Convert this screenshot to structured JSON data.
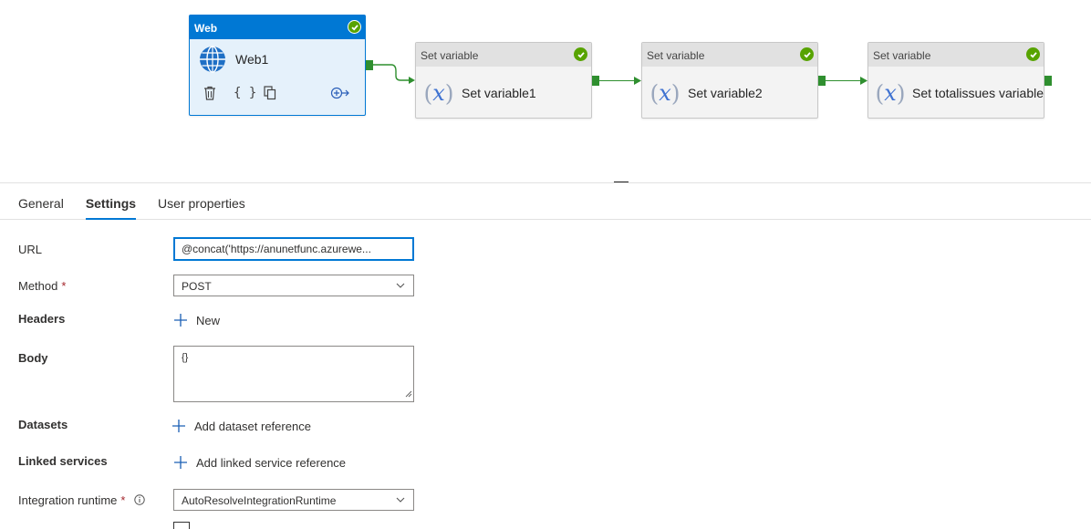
{
  "pipeline": {
    "web_activity": {
      "type_label": "Web",
      "name": "Web1",
      "icon": "globe-icon",
      "status": "succeeded"
    },
    "set_variable_1": {
      "type_label": "Set variable",
      "name": "Set variable1",
      "icon": "variable-icon"
    },
    "set_variable_2": {
      "type_label": "Set variable",
      "name": "Set variable2",
      "icon": "variable-icon"
    },
    "set_variable_3": {
      "type_label": "Set variable",
      "name": "Set totalissues variable",
      "icon": "variable-icon"
    }
  },
  "tabs": [
    {
      "label": "General",
      "active": false
    },
    {
      "label": "Settings",
      "active": true
    },
    {
      "label": "User properties",
      "active": false
    }
  ],
  "settings": {
    "url_label": "URL",
    "url_value": "@concat('https://anunetfunc.azurewe...",
    "method_label": "Method",
    "method_value": "POST",
    "headers_label": "Headers",
    "headers_new": "New",
    "body_label": "Body",
    "body_value": "{}",
    "datasets_label": "Datasets",
    "datasets_add": "Add dataset reference",
    "linked_label": "Linked services",
    "linked_add": "Add linked service reference",
    "runtime_label": "Integration runtime",
    "runtime_value": "AutoResolveIntegrationRuntime",
    "required_marker": "*"
  },
  "colors": {
    "accent": "#0078d4",
    "success": "#57a300",
    "connector": "#2f8f2f",
    "required": "#a4262c"
  }
}
